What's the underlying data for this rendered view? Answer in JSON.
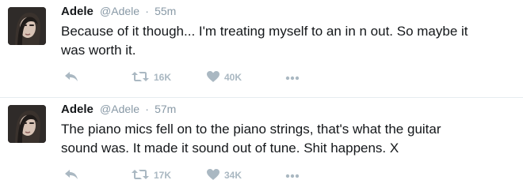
{
  "tweets": [
    {
      "user": {
        "name": "Adele",
        "handle": "@Adele",
        "avatar_icon": "portrait-avatar"
      },
      "separator": "·",
      "time": "55m",
      "text": "Because of it though... I'm treating myself to an in n out. So maybe it\nwas worth it.",
      "actions": {
        "reply_icon": "reply-icon",
        "retweet_icon": "retweet-icon",
        "retweet_count": "16K",
        "like_icon": "heart-icon",
        "like_count": "40K",
        "more_icon": "more-icon"
      }
    },
    {
      "user": {
        "name": "Adele",
        "handle": "@Adele",
        "avatar_icon": "portrait-avatar"
      },
      "separator": "·",
      "time": "57m",
      "text": "The piano mics fell on to the piano strings, that's what the guitar\nsound was. It made it sound out of tune. Shit happens. X",
      "actions": {
        "reply_icon": "reply-icon",
        "retweet_icon": "retweet-icon",
        "retweet_count": "17K",
        "like_icon": "heart-icon",
        "like_count": "34K",
        "more_icon": "more-icon"
      }
    }
  ],
  "colors": {
    "text": "#14171a",
    "secondary": "#8899a6",
    "action_icon": "#aab8c2",
    "divider": "#e6ecf0"
  }
}
